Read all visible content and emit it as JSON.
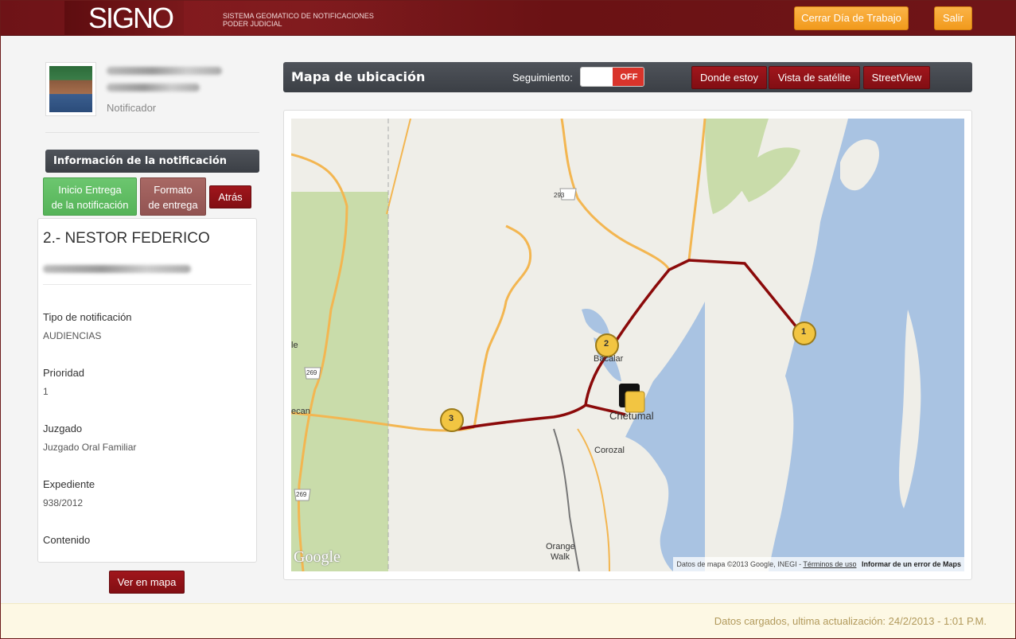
{
  "header": {
    "logo": "SIGNO",
    "subtitle_line1": "SISTEMA GEOMATICO DE NOTIFICACIONES",
    "subtitle_line2": "PODER JUDICIAL",
    "close_day_label": "Cerrar Día de Trabajo",
    "logout_label": "Salir"
  },
  "profile": {
    "role": "Notificador"
  },
  "info": {
    "title": "Información de la notificación",
    "start_delivery_line1": "Inicio Entrega",
    "start_delivery_line2": "de la notificación",
    "format_line1": "Formato",
    "format_line2": "de entrega",
    "back_label": "Atrás",
    "recipient": "2.- NESTOR FEDERICO",
    "fields": [
      {
        "label": "Tipo de notificación",
        "value": "AUDIENCIAS"
      },
      {
        "label": "Prioridad",
        "value": "1"
      },
      {
        "label": "Juzgado",
        "value": "Juzgado Oral Familiar"
      },
      {
        "label": "Expediente",
        "value": "938/2012"
      },
      {
        "label": "Contenido",
        "value": ""
      }
    ],
    "view_map_label": "Ver en mapa"
  },
  "map_panel": {
    "title": "Mapa de ubicación",
    "tracking_label": "Seguimiento:",
    "tracking_state": "OFF",
    "where_am_i_label": "Donde estoy",
    "satellite_label": "Vista de satélite",
    "streetview_label": "StreetView"
  },
  "map": {
    "places": [
      "Bacalar",
      "Chetumal",
      "Corozal",
      "Orange",
      "Walk",
      "ecan",
      "le"
    ],
    "road_shields": [
      "293",
      "269",
      "269"
    ],
    "markers": [
      "1",
      "2",
      "3"
    ],
    "logo": "Google",
    "attribution": "Datos de mapa ©2013 Google, INEGI - ",
    "terms": "Términos de uso",
    "report": "Informar de un error de Maps",
    "colors": {
      "water": "#a9c3e2",
      "land": "#efeee8",
      "park": "#c9dcaa",
      "route": "#8b0a0a",
      "road": "#f3b651"
    }
  },
  "footer": {
    "status": "Datos cargados, ultima actualización: 24/2/2013 - 1:01 P.M."
  }
}
